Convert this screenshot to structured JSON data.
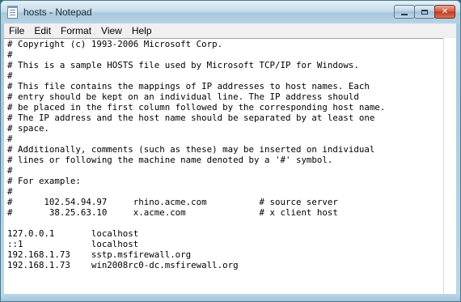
{
  "window": {
    "title": "hosts - Notepad",
    "icon": "notepad-icon",
    "controls": {
      "minimize": "minimize-icon",
      "maximize": "maximize-icon",
      "close": "close-icon"
    }
  },
  "menu": {
    "file": "File",
    "edit": "Edit",
    "format": "Format",
    "view": "View",
    "help": "Help"
  },
  "editor": {
    "lines": [
      "# Copyright (c) 1993-2006 Microsoft Corp.",
      "#",
      "# This is a sample HOSTS file used by Microsoft TCP/IP for Windows.",
      "#",
      "# This file contains the mappings of IP addresses to host names. Each",
      "# entry should be kept on an individual line. The IP address should",
      "# be placed in the first column followed by the corresponding host name.",
      "# The IP address and the host name should be separated by at least one",
      "# space.",
      "#",
      "# Additionally, comments (such as these) may be inserted on individual",
      "# lines or following the machine name denoted by a '#' symbol.",
      "#",
      "# For example:",
      "#",
      "#      102.54.94.97     rhino.acme.com          # source server",
      "#       38.25.63.10     x.acme.com              # x client host",
      "",
      "127.0.0.1       localhost",
      "::1             localhost",
      "192.168.1.73    sstp.msfirewall.org",
      "192.168.1.73    win2008rc0-dc.msfirewall.org"
    ]
  },
  "colors": {
    "titlebar": "#b8d3e4",
    "close_button": "#c03a22",
    "editor_background": "#ffffff"
  }
}
